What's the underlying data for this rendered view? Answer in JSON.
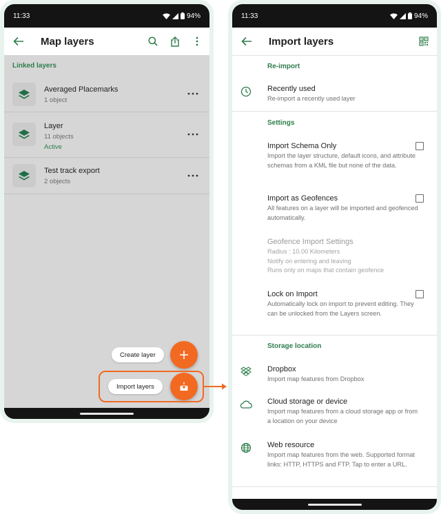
{
  "left": {
    "status": {
      "time": "11:33",
      "battery": "94%"
    },
    "appbar": {
      "title": "Map layers"
    },
    "section": "Linked layers",
    "layers": [
      {
        "name": "Averaged Placemarks",
        "count": "1 object",
        "status": ""
      },
      {
        "name": "Layer",
        "count": "11 objects",
        "status": "Active"
      },
      {
        "name": "Test track export",
        "count": "2 objects",
        "status": ""
      }
    ],
    "fab": {
      "create_label": "Create layer",
      "import_label": "Import layers"
    }
  },
  "right": {
    "status": {
      "time": "11:33",
      "battery": "94%"
    },
    "appbar": {
      "title": "Import layers"
    },
    "sections": {
      "reimport": "Re-import",
      "settings": "Settings",
      "storage": "Storage location"
    },
    "recently_used": {
      "title": "Recently used",
      "desc": "Re-import a recently used layer"
    },
    "import_schema": {
      "title": "Import Schema Only",
      "desc": "Import the layer structure, default icons, and attribute schemas from a KML file but none of the data.",
      "checked": false
    },
    "import_geofences": {
      "title": "Import as Geofences",
      "desc": "All features on a layer will be imported and geofenced automatically.",
      "checked": false
    },
    "geofence_settings": {
      "title": "Geofence Import Settings",
      "line1": "Radius : 10.00 Kilometers",
      "line2": "Notify on entering and leaving",
      "line3": "Runs only on maps that contain geofence"
    },
    "lock_import": {
      "title": "Lock on Import",
      "desc": "Automatically lock on import to prevent editing. They can be unlocked from the Layers screen.",
      "checked": false
    },
    "dropbox": {
      "title": "Dropbox",
      "desc": "Import map features from Dropbox"
    },
    "cloud": {
      "title": "Cloud storage or device",
      "desc": "Import map features from a cloud storage app or from a location on your device"
    },
    "web": {
      "title": "Web resource",
      "desc": "Import map features from the web. Supported format links: HTTP, HTTPS and FTP. Tap to enter a URL."
    }
  },
  "colors": {
    "accent": "#f26a22",
    "green": "#2e7d4b",
    "statusbar": "#141414"
  }
}
